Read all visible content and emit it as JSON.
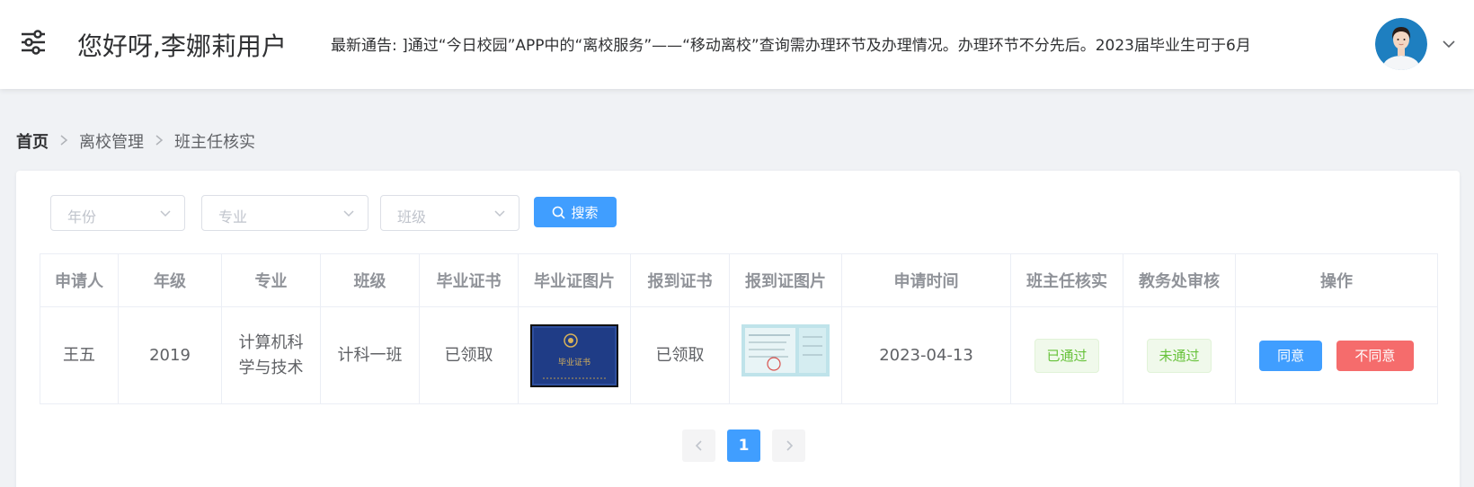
{
  "header": {
    "greeting": "您好呀,李娜莉用户",
    "notice": "最新通告: ]通过“今日校园”APP中的“离校服务”——“移动离校”查询需办理环节及办理情况。办理环节不分先后。2023届毕业生可于6月"
  },
  "breadcrumb": {
    "home": "首页",
    "section": "离校管理",
    "current": "班主任核实"
  },
  "filters": {
    "year_placeholder": "年份",
    "major_placeholder": "专业",
    "class_placeholder": "班级",
    "search_label": "搜索"
  },
  "table": {
    "headers": [
      "申请人",
      "年级",
      "专业",
      "班级",
      "毕业证书",
      "毕业证图片",
      "报到证书",
      "报到证图片",
      "申请时间",
      "班主任核实",
      "教务处审核",
      "操作"
    ],
    "rows": [
      {
        "applicant": "王五",
        "grade": "2019",
        "major": "计算机科学与技术",
        "class": "计科一班",
        "diploma": "已领取",
        "diploma_image_caption": "毕业证书",
        "report_cert": "已领取",
        "apply_time": "2023-04-13",
        "teacher_check": "已通过",
        "office_review": "未通过",
        "agree_label": "同意",
        "disagree_label": "不同意"
      }
    ]
  },
  "pagination": {
    "current_page": "1"
  },
  "colors": {
    "primary": "#409eff",
    "danger": "#f56c6c",
    "success": "#67c23a"
  }
}
